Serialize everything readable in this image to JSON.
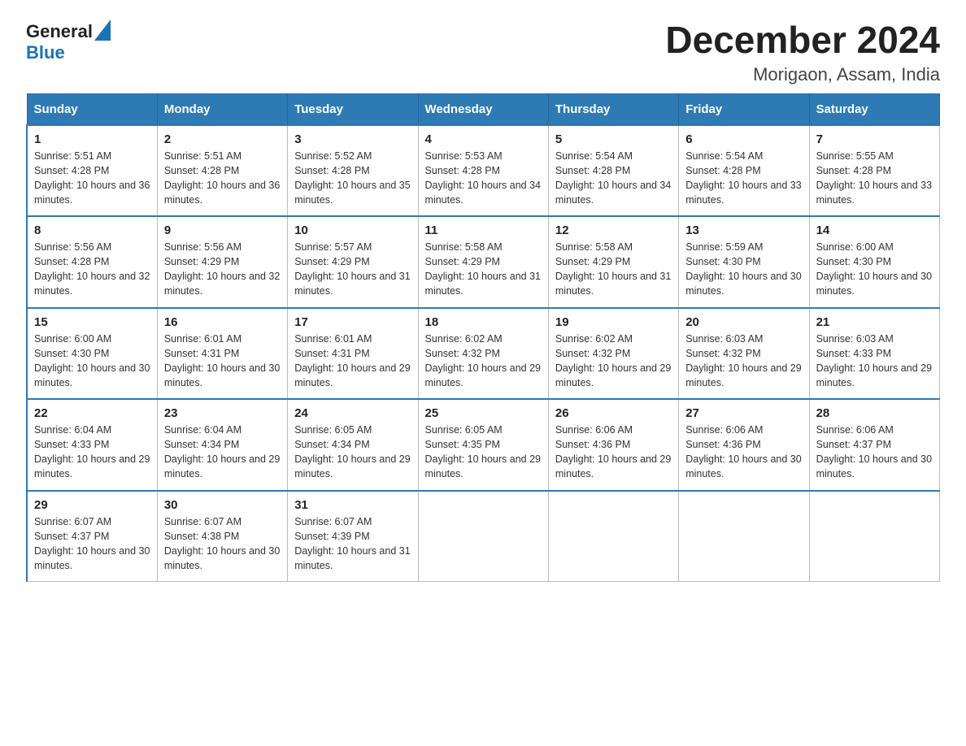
{
  "logo": {
    "general": "General",
    "blue": "Blue"
  },
  "title": "December 2024",
  "subtitle": "Morigaon, Assam, India",
  "days_of_week": [
    "Sunday",
    "Monday",
    "Tuesday",
    "Wednesday",
    "Thursday",
    "Friday",
    "Saturday"
  ],
  "weeks": [
    [
      {
        "day": "1",
        "sunrise": "5:51 AM",
        "sunset": "4:28 PM",
        "daylight": "10 hours and 36 minutes."
      },
      {
        "day": "2",
        "sunrise": "5:51 AM",
        "sunset": "4:28 PM",
        "daylight": "10 hours and 36 minutes."
      },
      {
        "day": "3",
        "sunrise": "5:52 AM",
        "sunset": "4:28 PM",
        "daylight": "10 hours and 35 minutes."
      },
      {
        "day": "4",
        "sunrise": "5:53 AM",
        "sunset": "4:28 PM",
        "daylight": "10 hours and 34 minutes."
      },
      {
        "day": "5",
        "sunrise": "5:54 AM",
        "sunset": "4:28 PM",
        "daylight": "10 hours and 34 minutes."
      },
      {
        "day": "6",
        "sunrise": "5:54 AM",
        "sunset": "4:28 PM",
        "daylight": "10 hours and 33 minutes."
      },
      {
        "day": "7",
        "sunrise": "5:55 AM",
        "sunset": "4:28 PM",
        "daylight": "10 hours and 33 minutes."
      }
    ],
    [
      {
        "day": "8",
        "sunrise": "5:56 AM",
        "sunset": "4:28 PM",
        "daylight": "10 hours and 32 minutes."
      },
      {
        "day": "9",
        "sunrise": "5:56 AM",
        "sunset": "4:29 PM",
        "daylight": "10 hours and 32 minutes."
      },
      {
        "day": "10",
        "sunrise": "5:57 AM",
        "sunset": "4:29 PM",
        "daylight": "10 hours and 31 minutes."
      },
      {
        "day": "11",
        "sunrise": "5:58 AM",
        "sunset": "4:29 PM",
        "daylight": "10 hours and 31 minutes."
      },
      {
        "day": "12",
        "sunrise": "5:58 AM",
        "sunset": "4:29 PM",
        "daylight": "10 hours and 31 minutes."
      },
      {
        "day": "13",
        "sunrise": "5:59 AM",
        "sunset": "4:30 PM",
        "daylight": "10 hours and 30 minutes."
      },
      {
        "day": "14",
        "sunrise": "6:00 AM",
        "sunset": "4:30 PM",
        "daylight": "10 hours and 30 minutes."
      }
    ],
    [
      {
        "day": "15",
        "sunrise": "6:00 AM",
        "sunset": "4:30 PM",
        "daylight": "10 hours and 30 minutes."
      },
      {
        "day": "16",
        "sunrise": "6:01 AM",
        "sunset": "4:31 PM",
        "daylight": "10 hours and 30 minutes."
      },
      {
        "day": "17",
        "sunrise": "6:01 AM",
        "sunset": "4:31 PM",
        "daylight": "10 hours and 29 minutes."
      },
      {
        "day": "18",
        "sunrise": "6:02 AM",
        "sunset": "4:32 PM",
        "daylight": "10 hours and 29 minutes."
      },
      {
        "day": "19",
        "sunrise": "6:02 AM",
        "sunset": "4:32 PM",
        "daylight": "10 hours and 29 minutes."
      },
      {
        "day": "20",
        "sunrise": "6:03 AM",
        "sunset": "4:32 PM",
        "daylight": "10 hours and 29 minutes."
      },
      {
        "day": "21",
        "sunrise": "6:03 AM",
        "sunset": "4:33 PM",
        "daylight": "10 hours and 29 minutes."
      }
    ],
    [
      {
        "day": "22",
        "sunrise": "6:04 AM",
        "sunset": "4:33 PM",
        "daylight": "10 hours and 29 minutes."
      },
      {
        "day": "23",
        "sunrise": "6:04 AM",
        "sunset": "4:34 PM",
        "daylight": "10 hours and 29 minutes."
      },
      {
        "day": "24",
        "sunrise": "6:05 AM",
        "sunset": "4:34 PM",
        "daylight": "10 hours and 29 minutes."
      },
      {
        "day": "25",
        "sunrise": "6:05 AM",
        "sunset": "4:35 PM",
        "daylight": "10 hours and 29 minutes."
      },
      {
        "day": "26",
        "sunrise": "6:06 AM",
        "sunset": "4:36 PM",
        "daylight": "10 hours and 29 minutes."
      },
      {
        "day": "27",
        "sunrise": "6:06 AM",
        "sunset": "4:36 PM",
        "daylight": "10 hours and 30 minutes."
      },
      {
        "day": "28",
        "sunrise": "6:06 AM",
        "sunset": "4:37 PM",
        "daylight": "10 hours and 30 minutes."
      }
    ],
    [
      {
        "day": "29",
        "sunrise": "6:07 AM",
        "sunset": "4:37 PM",
        "daylight": "10 hours and 30 minutes."
      },
      {
        "day": "30",
        "sunrise": "6:07 AM",
        "sunset": "4:38 PM",
        "daylight": "10 hours and 30 minutes."
      },
      {
        "day": "31",
        "sunrise": "6:07 AM",
        "sunset": "4:39 PM",
        "daylight": "10 hours and 31 minutes."
      },
      null,
      null,
      null,
      null
    ]
  ]
}
